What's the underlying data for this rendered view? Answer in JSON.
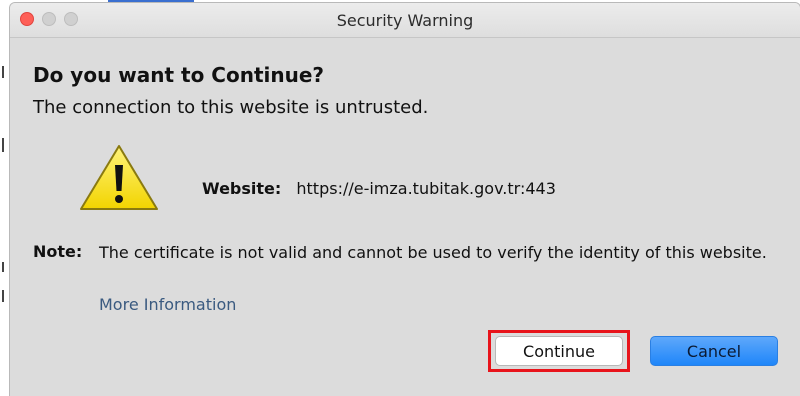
{
  "window": {
    "title": "Security Warning"
  },
  "dialog": {
    "heading": "Do you want to Continue?",
    "subheading": "The connection to this website is untrusted.",
    "website_label": "Website:",
    "website_value": "https://e-imza.tubitak.gov.tr:443",
    "note_label": "Note:",
    "note_text": "The certificate is not valid and cannot be used to verify the identity of this website.",
    "more_info_link": "More Information"
  },
  "buttons": {
    "continue_label": "Continue",
    "cancel_label": "Cancel"
  },
  "icons": {
    "warning": "warning-icon",
    "close": "close-icon",
    "minimize": "minimize-icon",
    "zoom": "zoom-icon"
  },
  "colors": {
    "highlight_border": "#e8141b",
    "primary_button": "#1f86f9",
    "link": "#3a5a80"
  }
}
